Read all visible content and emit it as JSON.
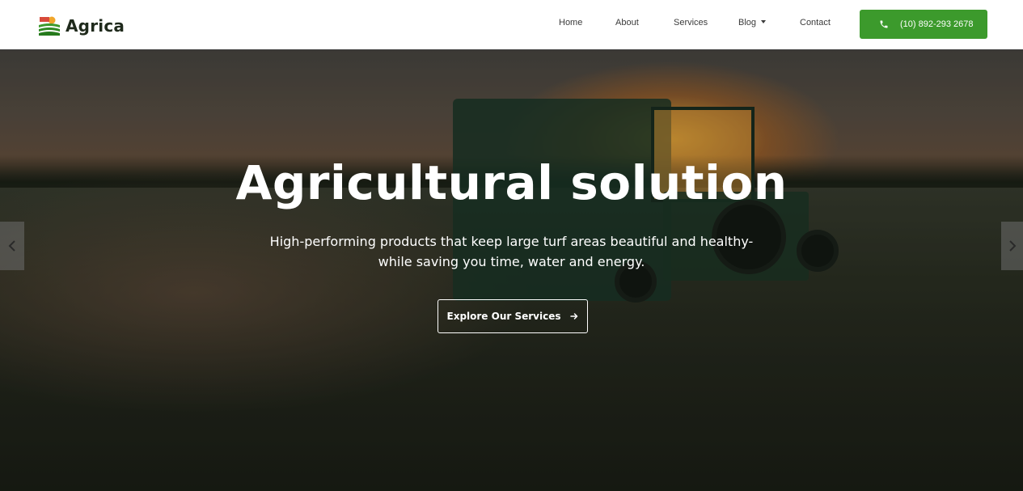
{
  "brand": {
    "name": "Agrica",
    "logo_icon": "farm-field-sun-icon"
  },
  "nav": {
    "items": [
      {
        "label": "Home"
      },
      {
        "label": "About"
      },
      {
        "label": "Services"
      },
      {
        "label": "Blog",
        "has_dropdown": true
      },
      {
        "label": "Contact"
      }
    ],
    "phone": {
      "label": "(10) 892-293 2678",
      "icon": "phone-icon"
    }
  },
  "hero": {
    "title": "Agricultural solution",
    "subtitle_line1": "High-performing products that keep large turf areas beautiful and healthy-",
    "subtitle_line2": "while saving you time, water and energy.",
    "cta_label": "Explore Our Services",
    "cta_icon": "arrow-right-icon",
    "prev_icon": "chevron-left-icon",
    "next_icon": "chevron-right-icon"
  },
  "colors": {
    "accent": "#3c9a2c",
    "text_dark": "#1f2a1c",
    "nav_text": "#3b3b3b"
  }
}
